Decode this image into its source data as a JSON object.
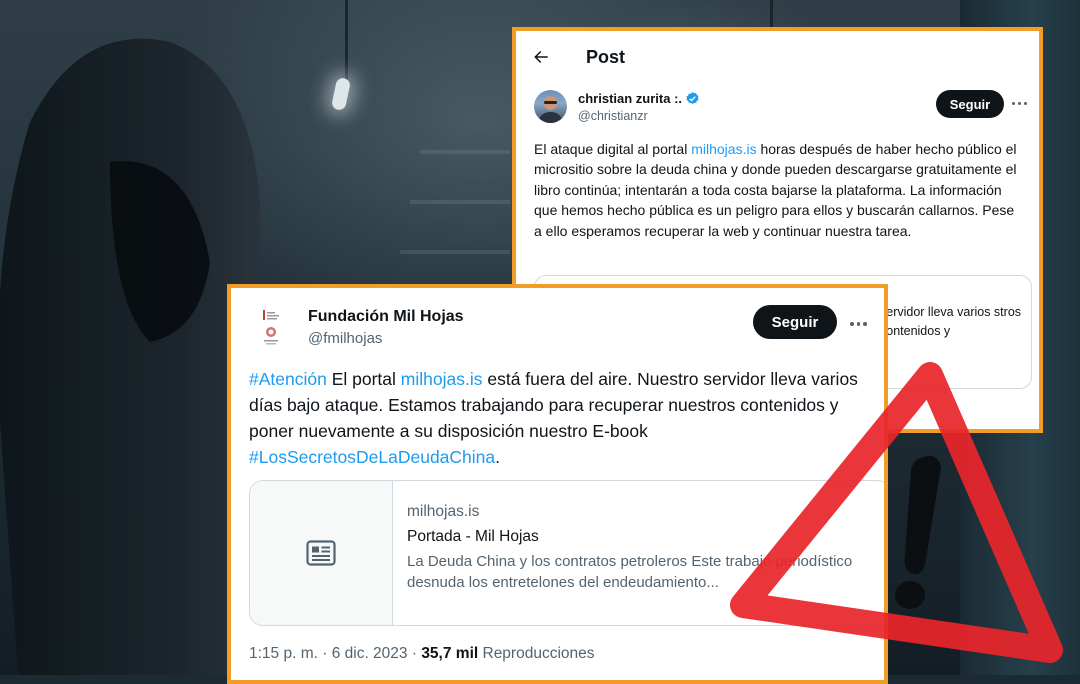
{
  "post1": {
    "header_title": "Post",
    "author_name": "christian zurita :.",
    "author_handle": "@christianzr",
    "follow_label": "Seguir",
    "text_before_link": "El ataque digital al portal ",
    "text_link": "milhojas.is",
    "text_after_link": " horas después de haber hecho público el micrositio sobre la deuda china y donde pueden descargarse gratuitamente el libro continúa; intentarán a toda costa bajarse la plataforma. La información que hemos hecho pública es un peligro para ellos y buscarán callarnos. Pese  a ello esperamos recuperar la web y continuar nuestra tarea.",
    "quote_visible_text": "servidor lleva varios stros contenidos y"
  },
  "post2": {
    "author_name": "Fundación Mil Hojas",
    "author_handle": "@fmilhojas",
    "follow_label": "Seguir",
    "hashtag1": "#Atención",
    "text_part1": " El portal ",
    "text_link": "milhojas.is",
    "text_part2": " está fuera del aire. Nuestro servidor lleva varios días bajo ataque. Estamos trabajando para recuperar nuestros contenidos y poner nuevamente a su disposición nuestro E-book ",
    "hashtag2": "#LosSecretosDeLaDeudaChina",
    "text_end": ".",
    "link_card": {
      "domain": "milhojas.is",
      "title": "Portada - Mil Hojas",
      "description": "La Deuda China y los contratos petroleros Este trabajo periodístico desnuda los entretelones del endeudamiento..."
    },
    "timestamp": "1:15 p. m. · 6 dic. 2023 · ",
    "views_count": "35,7 mil",
    "views_label": " Reproducciones"
  },
  "colors": {
    "card_border": "#f29d27",
    "link": "#1d9bf0",
    "warning_red": "#e8262b",
    "follow_button": "#0f1419"
  },
  "icons": [
    "back-arrow-icon",
    "verified-badge-icon",
    "more-options-icon",
    "article-icon",
    "warning-sign-icon"
  ]
}
